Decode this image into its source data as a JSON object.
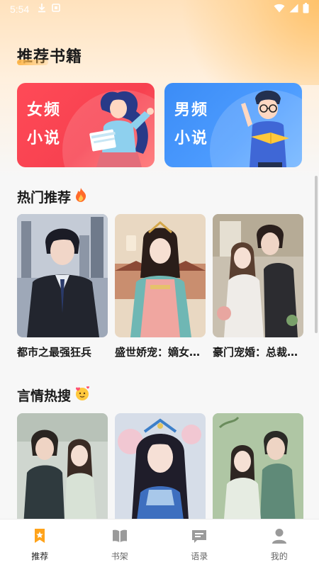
{
  "status_bar": {
    "time": "5:54",
    "icons": [
      "download-icon",
      "notification-icon",
      "wifi-icon",
      "signal-icon",
      "battery-icon"
    ]
  },
  "page": {
    "title": "推荐书籍"
  },
  "categories": [
    {
      "line1": "女频",
      "line2": "小说",
      "color": "#f7414f",
      "icon": "female-reader-illustration"
    },
    {
      "line1": "男频",
      "line2": "小说",
      "color": "#3d8ff7",
      "icon": "male-reader-illustration"
    }
  ],
  "hot_section": {
    "title": "热门推荐",
    "icon": "fire-icon",
    "books": [
      {
        "title": "都市之最强狂兵"
      },
      {
        "title": "盛世娇宠：嫡女归来"
      },
      {
        "title": "豪门宠婚：总裁的甜妻"
      }
    ]
  },
  "romance_section": {
    "title": "言情热搜",
    "icon": "hearts-face-icon",
    "books": [
      {
        "title": ""
      },
      {
        "title": ""
      },
      {
        "title": ""
      }
    ]
  },
  "bottom_nav": {
    "items": [
      {
        "label": "推荐",
        "icon": "bookmark-star-icon",
        "active": true
      },
      {
        "label": "书架",
        "icon": "open-book-icon",
        "active": false
      },
      {
        "label": "语录",
        "icon": "message-lines-icon",
        "active": false
      },
      {
        "label": "我的",
        "icon": "user-icon",
        "active": false
      }
    ],
    "active_color": "#ffa31a",
    "inactive_color": "#9a9a9a"
  }
}
